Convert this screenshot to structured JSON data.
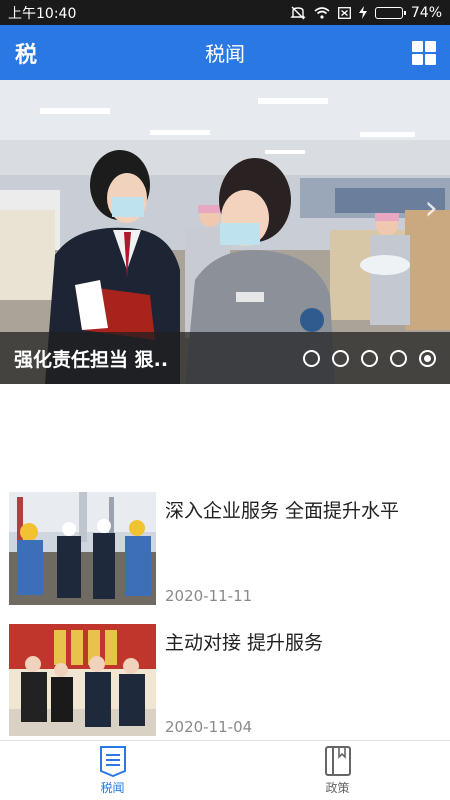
{
  "status_bar": {
    "time": "上午10:40",
    "battery": "74%",
    "battery_level": 0.74,
    "icons": [
      "mute-icon",
      "wifi-icon",
      "sim-icon",
      "charging-icon",
      "battery-icon"
    ]
  },
  "header": {
    "logo": "税",
    "title": "税闻",
    "menu_icon": "grid-menu-icon"
  },
  "banner": {
    "caption": "强化责任担当 狠..",
    "slide_count": 5,
    "active_slide": 5
  },
  "news": [
    {
      "title": "深入企业服务 全面提升水平",
      "date": "2020-11-11"
    },
    {
      "title": "主动对接 提升服务",
      "date": "2020-11-04"
    }
  ],
  "bottom_nav": {
    "items": [
      {
        "label": "税闻",
        "icon": "news-icon",
        "active": true
      },
      {
        "label": "政策",
        "icon": "policy-book-icon",
        "active": false
      }
    ]
  },
  "colors": {
    "primary": "#2a78e4",
    "status_bar": "#1a1a1a",
    "battery": "#7ed957"
  }
}
